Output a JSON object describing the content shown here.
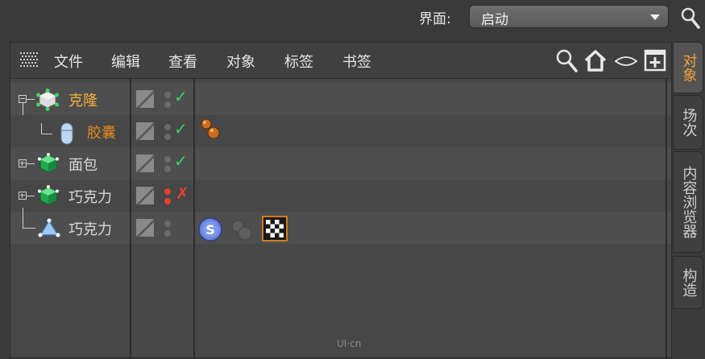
{
  "topbar": {
    "layout_label": "界面:",
    "layout_value": "启动"
  },
  "menu": {
    "items": [
      "文件",
      "编辑",
      "查看",
      "对象",
      "标签",
      "书签"
    ]
  },
  "objects": [
    {
      "name": "克隆",
      "color": "#f5b13a"
    },
    {
      "name": "胶囊",
      "color": "#e08a1e"
    },
    {
      "name": "面包",
      "color": "#d8d8d8"
    },
    {
      "name": "巧克力",
      "color": "#d8d8d8"
    },
    {
      "name": "巧克力",
      "color": "#d8d8d8"
    }
  ],
  "flags": {
    "check": "✓",
    "cross": "✗"
  },
  "tags": {
    "s_label": "S"
  },
  "side_tabs": [
    {
      "label": "对象",
      "active": true
    },
    {
      "label": "场次",
      "active": false
    },
    {
      "label": "内容浏览器",
      "active": false
    },
    {
      "label": "构造",
      "active": false
    }
  ],
  "watermark": "UI·cn"
}
